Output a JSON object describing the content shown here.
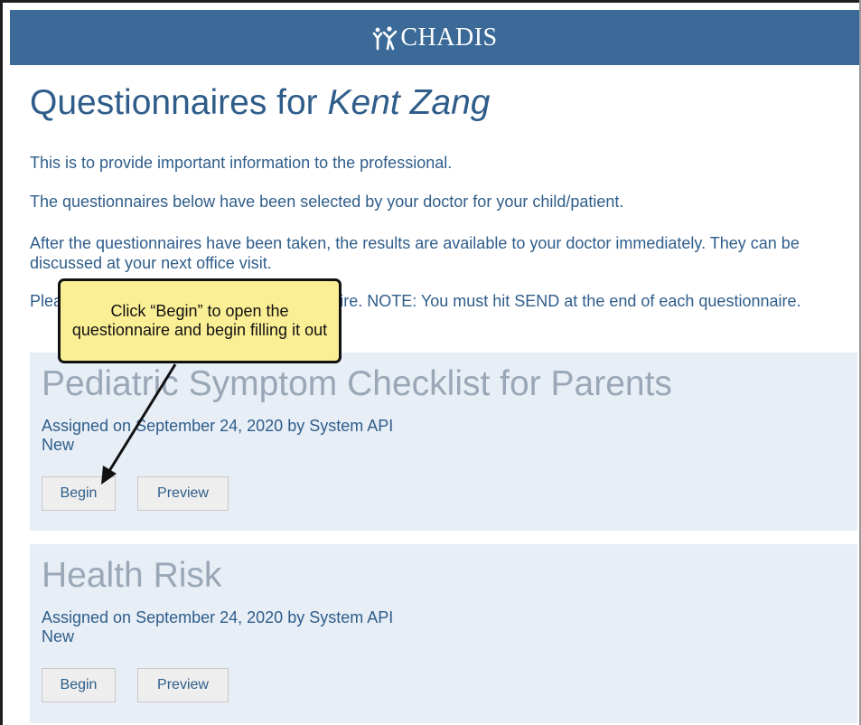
{
  "header": {
    "logo_text": "CHADIS",
    "brand_color": "#3b6a98"
  },
  "page": {
    "title_prefix": "Questionnaires for ",
    "patient_name": "Kent Zang",
    "paragraphs": [
      "This is to provide important information to the professional.",
      "The questionnaires below have been selected by your doctor for your child/patient.",
      "After the questionnaires have been taken, the results are available to your doctor immediately. They can be discussed at your next office visit.",
      "Please click Begin to start each questionnaire. NOTE: You must hit SEND at the end of each questionnaire."
    ]
  },
  "questionnaires": [
    {
      "title": "Pediatric Symptom Checklist for Parents",
      "assigned": "Assigned on September 24, 2020 by System API",
      "status": "New",
      "begin_label": "Begin",
      "preview_label": "Preview"
    },
    {
      "title": "Health Risk",
      "assigned": "Assigned on September 24, 2020 by System API",
      "status": "New",
      "begin_label": "Begin",
      "preview_label": "Preview"
    }
  ],
  "callout": {
    "text": "Click “Begin” to open the questionnaire and begin filling it out",
    "background": "#fbef95"
  },
  "colors": {
    "text_blue": "#2f5d8a",
    "card_bg": "#e8eef6",
    "card_title_gray": "#9aa7b6"
  }
}
